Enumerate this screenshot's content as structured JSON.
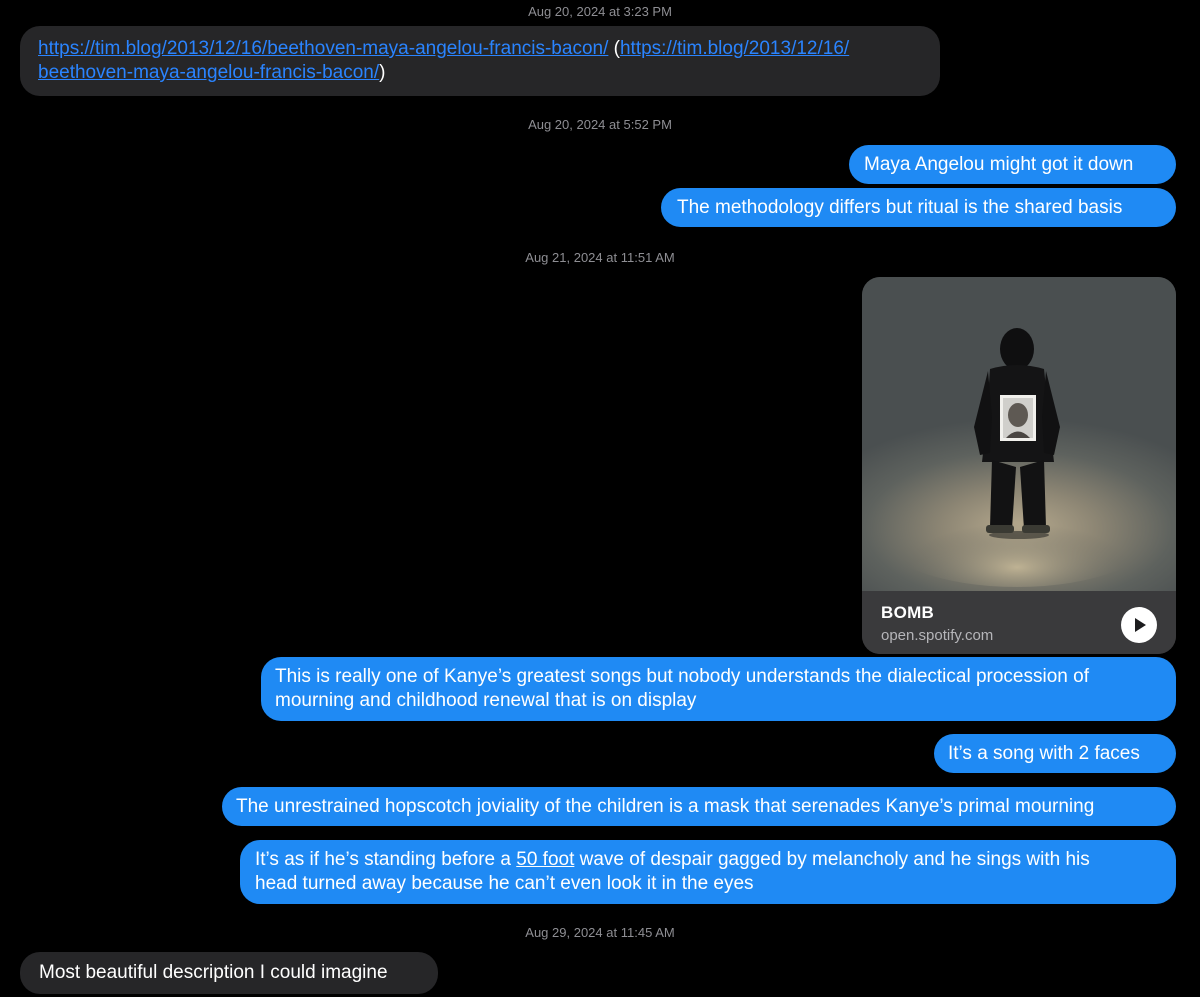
{
  "timestamps": [
    {
      "date": "Aug 20, 2024",
      "at": "at",
      "time": "3:23 PM"
    },
    {
      "date": "Aug 20, 2024",
      "at": "at",
      "time": "5:52 PM"
    },
    {
      "date": "Aug 21, 2024",
      "at": "at",
      "time": "11:51 AM"
    },
    {
      "date": "Aug 29, 2024",
      "at": "at",
      "time": "11:45 AM"
    }
  ],
  "messages": {
    "link_message": {
      "url": "https://tim.blog/2013/12/16/beethoven-maya-angelou-francis-bacon/",
      "open_paren": "(",
      "url_repeat_line1": "https://tim.blog/2013/12/16/",
      "url_repeat_line2": "beethoven-maya-angelou-francis-bacon/",
      "close_paren": ")"
    },
    "maya": "Maya Angelou might got it down",
    "methodology": "The methodology differs but ritual is the shared basis",
    "greatest_line1": "This is really one of Kanye’s greatest songs but nobody understands the dialectical procession of",
    "greatest_line2": "mourning and childhood renewal that is on display",
    "two_faces": "It’s a song with 2 faces",
    "hopscotch": "The unrestrained hopscotch joviality of the children is a mask that serenades Kanye’s primal mourning",
    "wave_line1_pre": "It’s as if he’s standing before a ",
    "wave_line1_link": "50 foot",
    "wave_line1_post": " wave of despair gagged by melancholy and he sings with his",
    "wave_line2": "head turned away because he can’t even look it in the eyes",
    "beautiful": "Most beautiful description I could imagine"
  },
  "link_preview": {
    "title": "BOMB",
    "domain": "open.spotify.com",
    "play_icon": "play-icon"
  },
  "colors": {
    "outgoing_bubble": "#1f8af4",
    "incoming_bubble": "#262628",
    "link": "#2a84ff",
    "timestamp": "#8e8e93",
    "background": "#000000"
  }
}
